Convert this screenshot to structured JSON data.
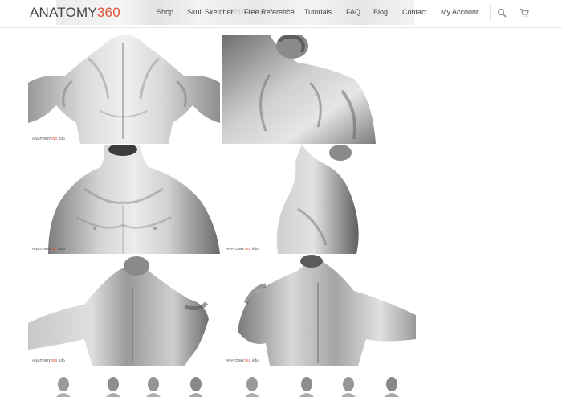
{
  "brand": {
    "word": "ANATOMY",
    "number": "360",
    "accent_color": "#e0543b"
  },
  "header_ghost": {
    "left": "ANATOMY",
    "right": "360"
  },
  "nav": {
    "items": [
      {
        "label": "Shop"
      },
      {
        "label": "Skull Sketcher"
      },
      {
        "label": "Free Reference"
      },
      {
        "label": "Tutorials"
      },
      {
        "label": "FAQ"
      },
      {
        "label": "Blog"
      },
      {
        "label": "Contact"
      },
      {
        "label": "My Account"
      }
    ],
    "search_icon": "search-icon",
    "cart_icon": "cart-icon"
  },
  "gallery": {
    "watermark": {
      "word": "ANATOMY",
      "number": "360",
      "suffix": ".info"
    },
    "tiles": [
      {
        "name": "back-upper-view"
      },
      {
        "name": "shoulder-side-view"
      },
      {
        "name": "chest-front-view"
      },
      {
        "name": "side-profile-view"
      },
      {
        "name": "back-three-quarter-left"
      },
      {
        "name": "back-three-quarter-right"
      }
    ],
    "thumbnail_count": 8
  }
}
